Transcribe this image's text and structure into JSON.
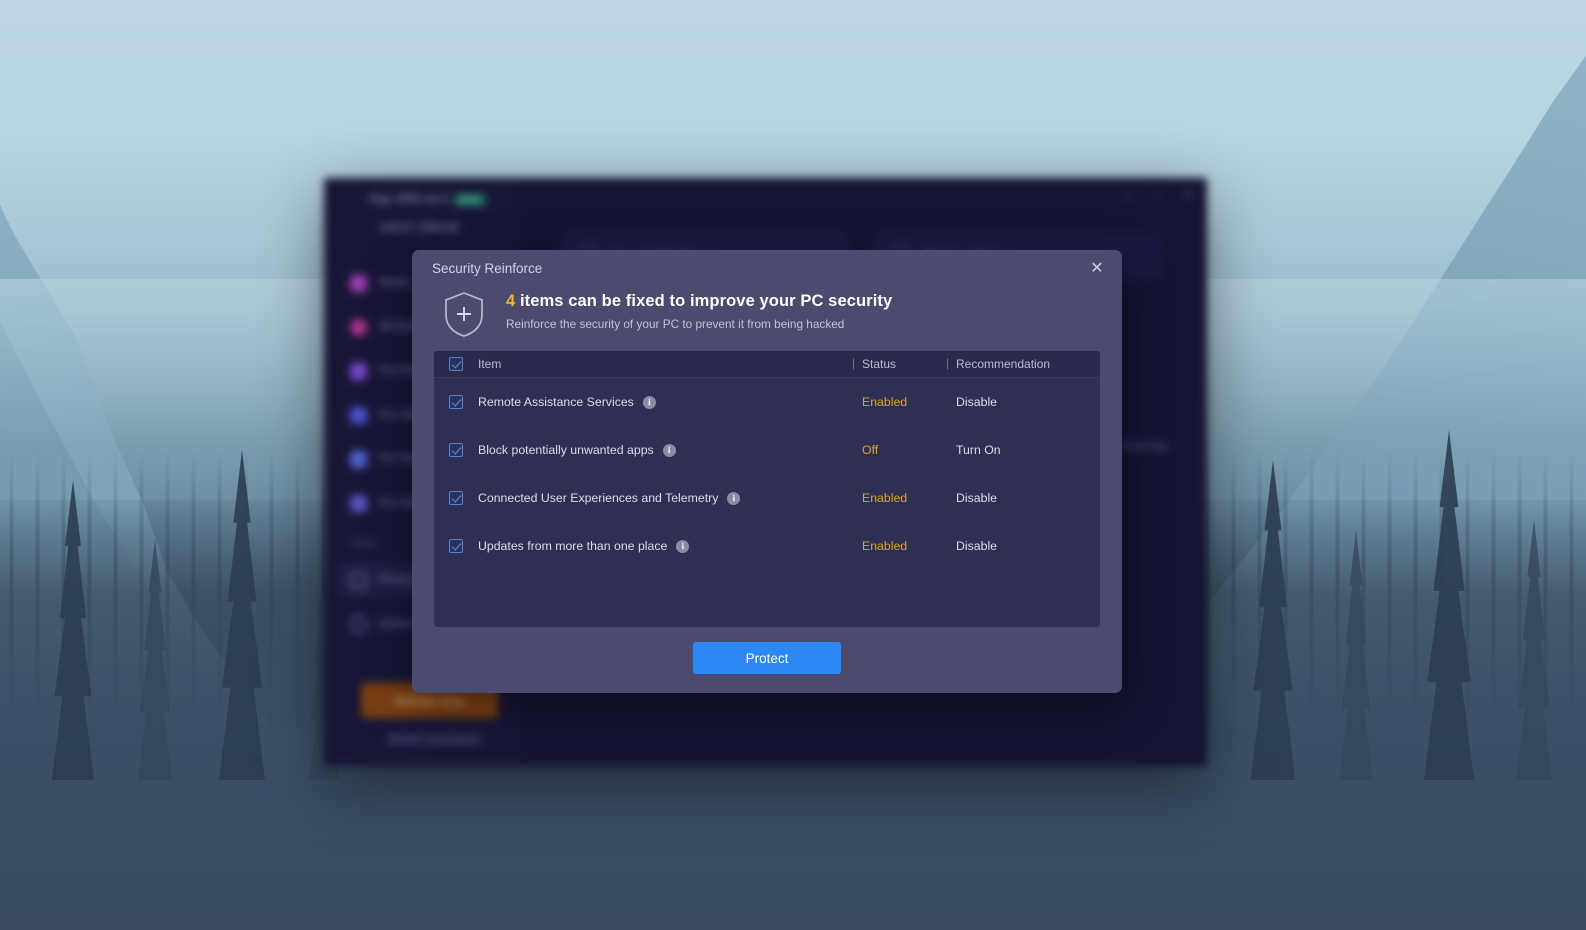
{
  "desktop": {
    "wallpaper_description": "misty blue mountain and pine forest landscape",
    "sky_color": "#bcd7e3",
    "forest_color": "#3b4f66"
  },
  "background_app": {
    "brand": "iTop VPN v4.4",
    "brand_badge": "PRO",
    "auth": {
      "login": "Log In",
      "divider": "|",
      "signup": "Sign Up"
    },
    "nav_items": [
      {
        "label": "Home",
        "icon": "home-icon",
        "color": "#9b3fb0"
      },
      {
        "label": "All Servers",
        "icon": "globe-icon",
        "color": "#b0348f"
      },
      {
        "label": "For Downloading",
        "icon": "download-icon",
        "color": "#7a46c8"
      },
      {
        "label": "For Streaming",
        "icon": "video-icon",
        "color": "#4b53c8"
      },
      {
        "label": "For Social Media",
        "icon": "people-icon",
        "color": "#4f63cf"
      },
      {
        "label": "For Gaming",
        "icon": "gamepad-icon",
        "color": "#5a55c0"
      }
    ],
    "tools_section_label": "Tools",
    "tool_items": [
      {
        "label": "Privacy Protection",
        "icon": "shield-tool-icon",
        "selected": true
      },
      {
        "label": "Quick Access",
        "icon": "link-icon",
        "selected": false
      }
    ],
    "activate_button": "Activate Now",
    "already_purchased": "Already Purchased?",
    "cards": [
      {
        "label": "Security Reinforce",
        "icon": "reinforce-icon"
      },
      {
        "label": "Browser Privacy",
        "icon": "browser-icon"
      }
    ],
    "side_note": "Scanning",
    "window_controls": [
      "minimize",
      "maximize",
      "close"
    ]
  },
  "dialog": {
    "title": "Security Reinforce",
    "close_label": "✕",
    "hero": {
      "icon": "shield-plus-icon",
      "count": "4",
      "headline_rest": " items can be fixed to improve your PC security",
      "subtitle": "Reinforce the security of your PC to prevent it from being hacked"
    },
    "table": {
      "select_all_checked": true,
      "columns": {
        "item": "Item",
        "status": "Status",
        "recommendation": "Recommendation"
      },
      "rows": [
        {
          "checked": true,
          "item": "Remote Assistance Services",
          "info": "info-icon",
          "status": "Enabled",
          "recommendation": "Disable"
        },
        {
          "checked": true,
          "item": "Block potentially unwanted apps",
          "info": "info-icon",
          "status": "Off",
          "recommendation": "Turn On"
        },
        {
          "checked": true,
          "item": "Connected User Experiences and Telemetry",
          "info": "info-icon",
          "status": "Enabled",
          "recommendation": "Disable"
        },
        {
          "checked": true,
          "item": "Updates from more than one place",
          "info": "info-icon",
          "status": "Enabled",
          "recommendation": "Disable"
        }
      ]
    },
    "protect_button": "Protect",
    "colors": {
      "dialog_bg": "#4a4b6e",
      "panel_bg": "#2e2f52",
      "accent_button": "#2b88f5",
      "status_warning": "#e0a32a",
      "count_highlight": "#f0b429"
    }
  }
}
